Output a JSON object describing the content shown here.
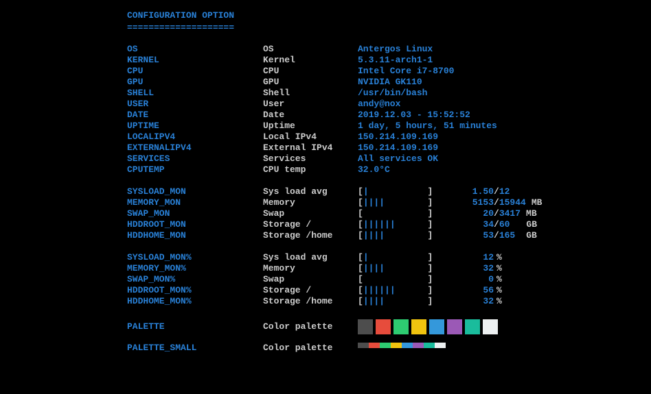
{
  "header": "CONFIGURATION OPTION",
  "underline": "====================",
  "info": {
    "os": {
      "key": "OS",
      "label": "OS",
      "value": "Antergos Linux"
    },
    "kernel": {
      "key": "KERNEL",
      "label": "Kernel",
      "value": "5.3.11-arch1-1"
    },
    "cpu": {
      "key": "CPU",
      "label": "CPU",
      "value": "Intel Core i7-8700"
    },
    "gpu": {
      "key": "GPU",
      "label": "GPU",
      "value": "NVIDIA GK110"
    },
    "shell": {
      "key": "SHELL",
      "label": "Shell",
      "value": "/usr/bin/bash"
    },
    "user": {
      "key": "USER",
      "label": "User",
      "value": "andy@nox"
    },
    "date": {
      "key": "DATE",
      "label": "Date",
      "value": "2019.12.03 - 15:52:52"
    },
    "uptime": {
      "key": "UPTIME",
      "label": "Uptime",
      "value": "1 day, 5 hours, 51 minutes"
    },
    "localip": {
      "key": "LOCALIPV4",
      "label": "Local IPv4",
      "value": "150.214.109.169"
    },
    "extip": {
      "key": "EXTERNALIPV4",
      "label": "External IPv4",
      "value": "150.214.109.169"
    },
    "services": {
      "key": "SERVICES",
      "label": "Services",
      "value": "All services OK"
    },
    "cputemp": {
      "key": "CPUTEMP",
      "label": "CPU temp",
      "value": "32.0°C"
    }
  },
  "monitors": {
    "sysload": {
      "key": "SYSLOAD_MON",
      "label": "Sys load avg",
      "bar": "|",
      "used": "1.50",
      "total": "12",
      "unit": ""
    },
    "memory": {
      "key": "MEMORY_MON",
      "label": "Memory",
      "bar": "||||",
      "used": "5153",
      "total": "15944",
      "unit": "MB"
    },
    "swap": {
      "key": "SWAP_MON",
      "label": "Swap",
      "bar": "",
      "used": "20",
      "total": "3417",
      "unit": "MB"
    },
    "hddroot": {
      "key": "HDDROOT_MON",
      "label": "Storage /",
      "bar": "||||||",
      "used": "34",
      "total": "60",
      "unit": "GB"
    },
    "hddhome": {
      "key": "HDDHOME_MON",
      "label": "Storage /home",
      "bar": "||||",
      "used": "53",
      "total": "165",
      "unit": "GB"
    }
  },
  "percents": {
    "sysload": {
      "key": "SYSLOAD_MON%",
      "label": "Sys load avg",
      "bar": "|",
      "pct": "12"
    },
    "memory": {
      "key": "MEMORY_MON%",
      "label": "Memory",
      "bar": "||||",
      "pct": "32"
    },
    "swap": {
      "key": "SWAP_MON%",
      "label": "Swap",
      "bar": "",
      "pct": "0"
    },
    "hddroot": {
      "key": "HDDROOT_MON%",
      "label": "Storage /",
      "bar": "||||||",
      "pct": "56"
    },
    "hddhome": {
      "key": "HDDHOME_MON%",
      "label": "Storage /home",
      "bar": "||||",
      "pct": "32"
    }
  },
  "palette": {
    "key": "PALETTE",
    "label": "Color palette",
    "colors": [
      "#4d4d4d",
      "#e74c3c",
      "#2ecc71",
      "#f1c40f",
      "#3498db",
      "#9b59b6",
      "#1abc9c",
      "#ecf0f1"
    ]
  },
  "palette_small": {
    "key": "PALETTE_SMALL",
    "label": "Color palette",
    "colors": [
      "#4d4d4d",
      "#e74c3c",
      "#2ecc71",
      "#f1c40f",
      "#3498db",
      "#9b59b6",
      "#1abc9c",
      "#ecf0f1"
    ]
  }
}
